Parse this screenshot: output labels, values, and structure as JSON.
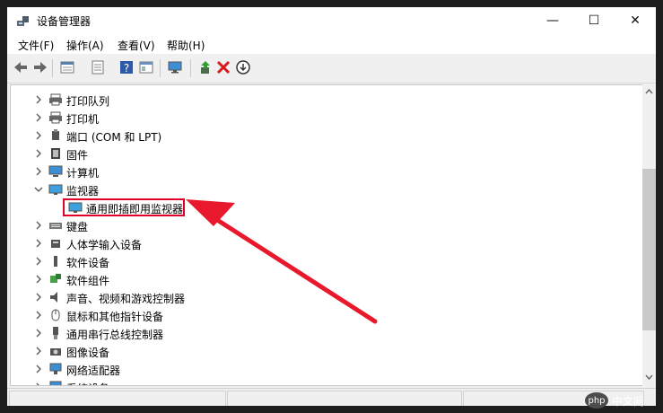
{
  "window": {
    "title": "设备管理器",
    "controls": {
      "minimize": "—",
      "maximize": "☐",
      "close": "✕"
    }
  },
  "menu": [
    "文件(F)",
    "操作(A)",
    "查看(V)",
    "帮助(H)"
  ],
  "toolbar": {
    "icons": [
      "back-icon",
      "forward-icon",
      "properties-icon",
      "details-icon",
      "help-icon",
      "show-hidden-icon",
      "monitor-icon",
      "update-driver-icon",
      "uninstall-icon",
      "disable-icon"
    ]
  },
  "tree": [
    {
      "label": "打印队列",
      "icon": "printer-icon",
      "expanded": false
    },
    {
      "label": "打印机",
      "icon": "printer-icon",
      "expanded": false
    },
    {
      "label": "端口 (COM 和 LPT)",
      "icon": "port-icon",
      "expanded": false
    },
    {
      "label": "固件",
      "icon": "firmware-icon",
      "expanded": false
    },
    {
      "label": "计算机",
      "icon": "computer-icon",
      "expanded": false
    },
    {
      "label": "监视器",
      "icon": "monitor-icon",
      "expanded": true
    },
    {
      "label": "通用即插即用监视器",
      "icon": "monitor-icon",
      "child": true,
      "selected": true
    },
    {
      "label": "键盘",
      "icon": "keyboard-icon",
      "expanded": false
    },
    {
      "label": "人体学输入设备",
      "icon": "hid-icon",
      "expanded": false
    },
    {
      "label": "软件设备",
      "icon": "software-device-icon",
      "expanded": false
    },
    {
      "label": "软件组件",
      "icon": "software-component-icon",
      "expanded": false
    },
    {
      "label": "声音、视频和游戏控制器",
      "icon": "sound-icon",
      "expanded": false
    },
    {
      "label": "鼠标和其他指针设备",
      "icon": "mouse-icon",
      "expanded": false
    },
    {
      "label": "通用串行总线控制器",
      "icon": "usb-icon",
      "expanded": false
    },
    {
      "label": "图像设备",
      "icon": "camera-icon",
      "expanded": false
    },
    {
      "label": "网络适配器",
      "icon": "network-icon",
      "expanded": false
    },
    {
      "label": "系统设备",
      "icon": "system-icon",
      "expanded": false
    }
  ],
  "annotation": {
    "color": "#e8192c"
  },
  "watermark": {
    "logo": "php",
    "text": "中文网"
  },
  "colors": {
    "highlight_border": "#e0002a",
    "arrow": "#e8192c"
  }
}
